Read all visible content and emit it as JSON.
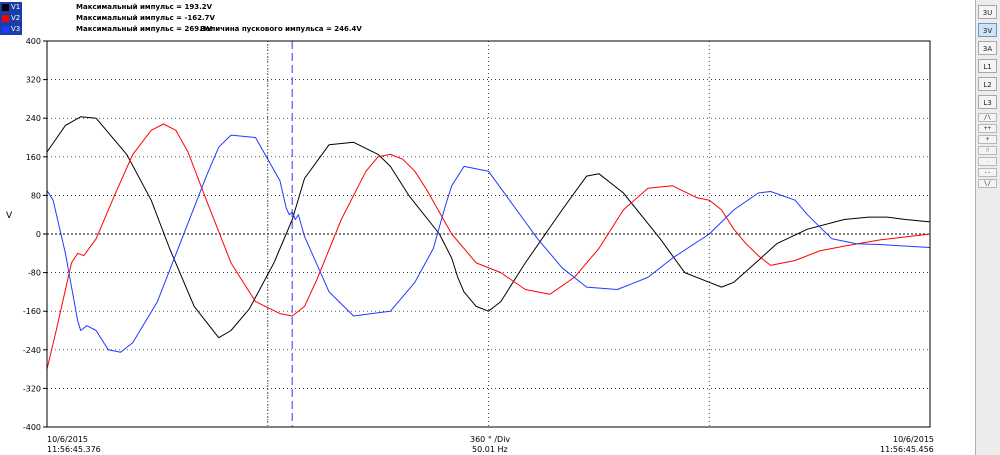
{
  "legend": [
    {
      "label": "V1",
      "color": "#000000",
      "text": "Максимальный импульс = 193.2V",
      "extra": ""
    },
    {
      "label": "V2",
      "color": "#ff0000",
      "text": "Максимальный импульс = -162.7V",
      "extra": ""
    },
    {
      "label": "V3",
      "color": "#1f3bff",
      "text": "Максимальный импульс = 269.3V",
      "extra": "Величина пускового импульса = 246.4V"
    }
  ],
  "sidebar": {
    "buttons": [
      "3U",
      "3V",
      "3A",
      "L1",
      "L2",
      "L3"
    ],
    "active": "3V",
    "small": [
      "/\\",
      "++",
      "+",
      "0",
      "-",
      "--",
      "\\/"
    ],
    "disabled_small": [
      "0",
      "-"
    ]
  },
  "footer": {
    "left_date": "10/6/2015",
    "left_time": "11:56:45.376",
    "center_div": "360 ° /Div",
    "center_freq": "50.01 Hz",
    "right_date": "10/6/2015",
    "right_time": "11:56:45.456"
  },
  "chart_data": {
    "type": "line",
    "ylabel": "V",
    "ylim": [
      -400,
      400
    ],
    "yticks": [
      400,
      320,
      240,
      160,
      80,
      0,
      -80,
      -160,
      -240,
      -320,
      -400
    ],
    "xlim": [
      0,
      1440
    ],
    "x_unit": "degrees",
    "x_major_ticks": [
      360,
      720,
      1080
    ],
    "cursor_x": [
      360
    ],
    "trigger_x": 400,
    "colors": {
      "grid_major": "#000000",
      "cursor": "#555555",
      "trigger": "#7878ff"
    },
    "series": [
      {
        "name": "V1",
        "color": "#000000",
        "x": [
          0,
          30,
          55,
          80,
          130,
          170,
          200,
          240,
          280,
          300,
          330,
          370,
          400,
          420,
          440,
          460,
          500,
          540,
          560,
          590,
          640,
          660,
          670,
          680,
          700,
          720,
          740,
          780,
          840,
          880,
          900,
          940,
          1000,
          1040,
          1080,
          1100,
          1120,
          1160,
          1190,
          1240,
          1300,
          1340,
          1370,
          1400,
          1440
        ],
        "y": [
          170,
          225,
          243,
          240,
          165,
          70,
          -30,
          -150,
          -215,
          -200,
          -155,
          -60,
          30,
          115,
          150,
          185,
          190,
          165,
          140,
          80,
          0,
          -50,
          -90,
          -120,
          -150,
          -160,
          -140,
          -60,
          50,
          120,
          125,
          85,
          -10,
          -80,
          -100,
          -110,
          -100,
          -55,
          -20,
          10,
          30,
          35,
          35,
          30,
          25
        ]
      },
      {
        "name": "V2",
        "color": "#ff0000",
        "x": [
          0,
          15,
          40,
          50,
          60,
          80,
          110,
          140,
          170,
          190,
          210,
          230,
          260,
          300,
          340,
          380,
          400,
          420,
          440,
          480,
          520,
          540,
          560,
          580,
          600,
          620,
          660,
          700,
          740,
          780,
          820,
          860,
          900,
          940,
          980,
          1020,
          1060,
          1080,
          1100,
          1120,
          1140,
          1160,
          1180,
          1220,
          1260,
          1300,
          1360,
          1440
        ],
        "y": [
          -280,
          -200,
          -60,
          -40,
          -45,
          -10,
          80,
          165,
          215,
          228,
          215,
          170,
          70,
          -60,
          -140,
          -165,
          -170,
          -150,
          -95,
          30,
          130,
          160,
          165,
          155,
          130,
          90,
          0,
          -60,
          -80,
          -115,
          -125,
          -90,
          -30,
          50,
          95,
          100,
          75,
          70,
          50,
          10,
          -20,
          -45,
          -65,
          -55,
          -35,
          -25,
          -12,
          0
        ]
      },
      {
        "name": "V3",
        "color": "#1f3bff",
        "x": [
          0,
          10,
          30,
          50,
          55,
          65,
          80,
          100,
          120,
          140,
          180,
          220,
          260,
          280,
          300,
          340,
          380,
          390,
          395,
          400,
          405,
          410,
          420,
          460,
          500,
          560,
          600,
          630,
          650,
          660,
          680,
          720,
          760,
          800,
          840,
          880,
          930,
          980,
          1020,
          1080,
          1120,
          1160,
          1180,
          1220,
          1240,
          1280,
          1320,
          1360,
          1440
        ],
        "y": [
          90,
          70,
          -40,
          -180,
          -200,
          -190,
          -200,
          -240,
          -245,
          -225,
          -140,
          -10,
          120,
          180,
          205,
          200,
          110,
          55,
          40,
          45,
          30,
          40,
          -5,
          -120,
          -170,
          -160,
          -100,
          -30,
          60,
          100,
          140,
          130,
          60,
          -10,
          -70,
          -110,
          -115,
          -90,
          -50,
          0,
          50,
          85,
          88,
          70,
          40,
          -10,
          -20,
          -22,
          -28
        ]
      }
    ]
  }
}
